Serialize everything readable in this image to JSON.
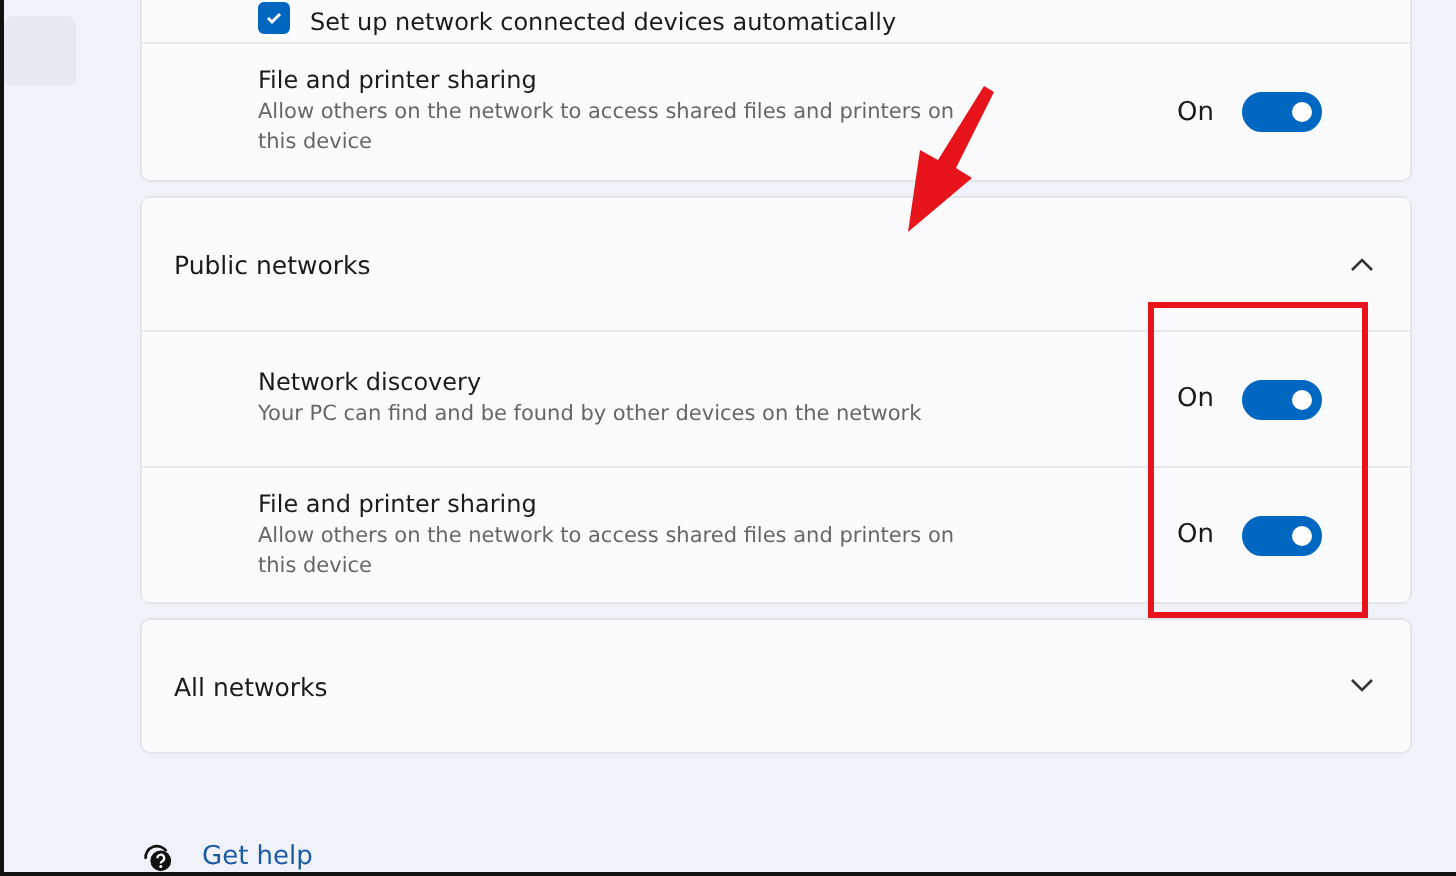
{
  "sections": [
    {
      "rows": [
        {
          "kind": "checkbox",
          "label": "Set up network connected devices automatically",
          "checked": true
        },
        {
          "kind": "toggle",
          "label": "File and printer sharing",
          "description": "Allow others on the network to access shared files and printers on this device",
          "state_label": "On",
          "on": true
        }
      ]
    },
    {
      "title": "Public networks",
      "expanded": true,
      "rows": [
        {
          "kind": "toggle",
          "label": "Network discovery",
          "description": "Your PC can find and be found by other devices on the network",
          "state_label": "On",
          "on": true
        },
        {
          "kind": "toggle",
          "label": "File and printer sharing",
          "description": "Allow others on the network to access shared files and printers on this device",
          "state_label": "On",
          "on": true
        }
      ]
    },
    {
      "title": "All networks",
      "expanded": false
    }
  ],
  "help_link": "Get help"
}
